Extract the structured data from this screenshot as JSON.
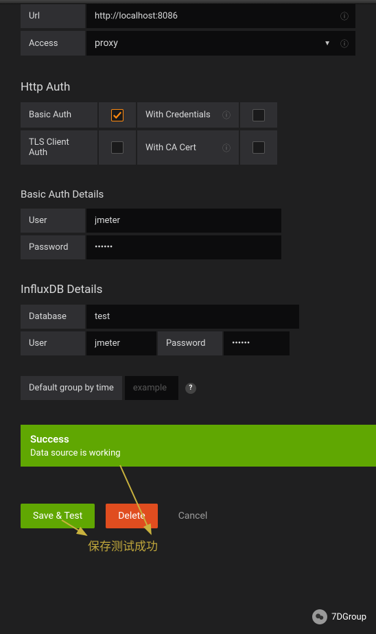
{
  "http_settings": {
    "url_label": "Url",
    "url_value": "http://localhost:8086",
    "access_label": "Access",
    "access_value": "proxy"
  },
  "http_auth": {
    "title": "Http Auth",
    "basic_auth_label": "Basic Auth",
    "basic_auth_checked": true,
    "with_credentials_label": "With Credentials",
    "with_credentials_checked": false,
    "tls_client_auth_label": "TLS Client Auth",
    "tls_client_auth_checked": false,
    "with_ca_cert_label": "With CA Cert",
    "with_ca_cert_checked": false
  },
  "basic_auth_details": {
    "title": "Basic Auth Details",
    "user_label": "User",
    "user_value": "jmeter",
    "password_label": "Password",
    "password_value": "••••••"
  },
  "influxdb": {
    "title": "InfluxDB Details",
    "database_label": "Database",
    "database_value": "test",
    "user_label": "User",
    "user_value": "jmeter",
    "password_label": "Password",
    "password_value": "••••••"
  },
  "group_by": {
    "label": "Default group by time",
    "placeholder": "example"
  },
  "alert": {
    "title": "Success",
    "message": "Data source is working"
  },
  "buttons": {
    "save": "Save & Test",
    "delete": "Delete",
    "cancel": "Cancel"
  },
  "annotation": "保存测试成功",
  "footer": "7DGroup"
}
